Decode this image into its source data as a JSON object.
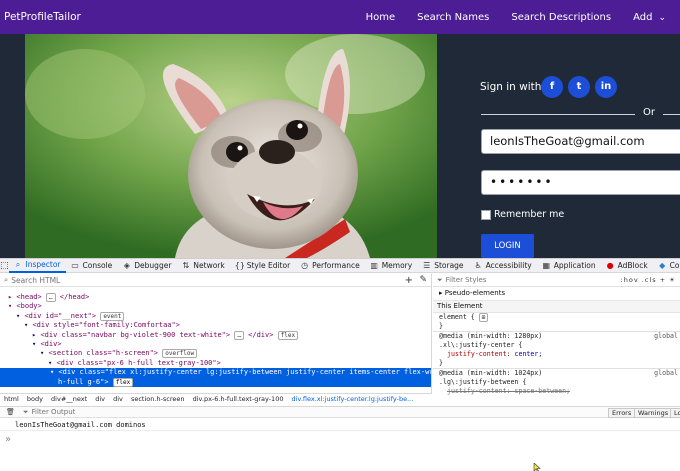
{
  "site": {
    "brand": "PetProfileTailor",
    "nav": [
      "Home",
      "Search Names",
      "Search Descriptions",
      "Add"
    ],
    "signin": {
      "label": "Sign in with",
      "social": [
        "f",
        "t",
        "in"
      ],
      "or": "Or",
      "email": "leonIsTheGoat@gmail.com",
      "password": "•••••••",
      "remember": "Remember me",
      "login": "LOGIN"
    },
    "colors": {
      "navbar": "#4c1d95",
      "panel": "#1f2937",
      "accent": "#1d4ed8"
    }
  },
  "devtools": {
    "tabs": [
      {
        "icon": "⌕",
        "label": "Inspector"
      },
      {
        "icon": "▭",
        "label": "Console"
      },
      {
        "icon": "◈",
        "label": "Debugger"
      },
      {
        "icon": "⇅",
        "label": "Network"
      },
      {
        "icon": "{}",
        "label": "Style Editor"
      },
      {
        "icon": "◷",
        "label": "Performance"
      },
      {
        "icon": "▥",
        "label": "Memory"
      },
      {
        "icon": "☰",
        "label": "Storage"
      },
      {
        "icon": "♿",
        "label": "Accessibility"
      },
      {
        "icon": "▦",
        "label": "Application"
      },
      {
        "icon": "●",
        "label": "AdBlock"
      },
      {
        "icon": "◆",
        "label": "Componen"
      }
    ],
    "search_placeholder": "Search HTML",
    "tree": {
      "l0": "▸ <head>",
      "l1": "▾ <body>",
      "l2_tag": "<div id=\"__next\">",
      "l2_badge": "event",
      "l3_tag": "<div style=\"font-family:Comfortaa\">",
      "l4_tag": "<div class=\"navbar bg-violet-900 text-white\">",
      "l4_end": "</div>",
      "l4_badge": "flex",
      "l5_tag": "<div>",
      "l6_tag": "<section class=\"h-screen\">",
      "l6_badge": "overflow",
      "l7_tag": "<div class=\"px-6 h-full text-gray-100\">",
      "l8_tag": "<div class=\"flex xl:justify-center lg:justify-between justify-center items-center flex-wrap",
      "l9_tag": "h-full g-6\">",
      "l9_badge": "flex"
    },
    "crumbs": [
      "html",
      "body",
      "div#__next",
      "div",
      "div",
      "section.h-screen",
      "div.px-6.h-full.text-gray-100",
      "div.flex.xl:justify-center.lg:justify-be..."
    ],
    "styles": {
      "filter_placeholder": "Filter Styles",
      "hov_cls": ":hov .cls",
      "pseudo": "Pseudo-elements",
      "this_element": "This Element",
      "element_rule": "element {",
      "close": "}",
      "media1": "@media (min-width: 1280px)",
      "sel1": ".xl\\:justify-center {",
      "prop1": "justify-content",
      "val1": "center;",
      "src1": "global",
      "media2": "@media (min-width: 1024px)",
      "sel2": ".lg\\:justify-between {",
      "prop2": "justify-content: space-between;",
      "src2": "global"
    },
    "console": {
      "filter_placeholder": "Filter Output",
      "errors": "Errors",
      "warnings": "Warnings",
      "logs": "Log",
      "output": "leonIsTheGoat@gmail.com dominos",
      "prompt": "»"
    }
  }
}
